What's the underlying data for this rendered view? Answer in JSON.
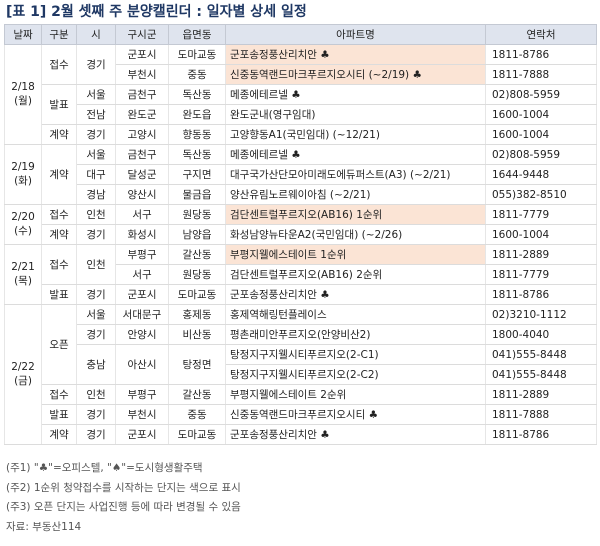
{
  "title": "[표 1] 2월 셋째 주 분양캘린더 : 일자별 상세 일정",
  "columns": [
    "날짜",
    "구분",
    "시",
    "구시군",
    "읍면동",
    "아파트명",
    "연락처"
  ],
  "dates": [
    "2/18 (월)",
    "2/19 (화)",
    "2/20 (수)",
    "2/21 (목)",
    "2/22 (금)"
  ],
  "types": [
    "접수",
    "발표",
    "계약",
    "계약",
    "접수",
    "계약",
    "접수",
    "발표",
    "오픈",
    "접수",
    "발표",
    "계약"
  ],
  "cities": [
    "경기",
    "서울",
    "전남",
    "경기",
    "서울",
    "대구",
    "경남",
    "인천",
    "경기",
    "인천",
    "경기",
    "서울",
    "경기",
    "충남",
    "인천",
    "경기",
    "경기"
  ],
  "rows": [
    {
      "gu": "군포시",
      "dong": "도마교동",
      "apt": "군포송정풍산리치안 ♣",
      "phone": "1811-8786",
      "highlight": true
    },
    {
      "gu": "부천시",
      "dong": "중동",
      "apt": "신중동역랜드마크푸르지오시티 (~2/19) ♣",
      "phone": "1811-7888",
      "highlight": true
    },
    {
      "gu": "금천구",
      "dong": "독산동",
      "apt": "메종에테르넬 ♣",
      "phone": "02)808-5959",
      "highlight": false
    },
    {
      "gu": "완도군",
      "dong": "완도읍",
      "apt": "완도군내(영구임대)",
      "phone": "1600-1004",
      "highlight": false
    },
    {
      "gu": "고양시",
      "dong": "향동동",
      "apt": "고양향동A1(국민임대) (~12/21)",
      "phone": "1600-1004",
      "highlight": false
    },
    {
      "gu": "금천구",
      "dong": "독산동",
      "apt": "메종에테르넬 ♣",
      "phone": "02)808-5959",
      "highlight": false
    },
    {
      "gu": "달성군",
      "dong": "구지면",
      "apt": "대구국가산단모아미래도에듀퍼스트(A3) (~2/21)",
      "phone": "1644-9448",
      "highlight": false
    },
    {
      "gu": "양산시",
      "dong": "물금읍",
      "apt": "양산유림노르웨이아침 (~2/21)",
      "phone": "055)382-8510",
      "highlight": false
    },
    {
      "gu": "서구",
      "dong": "원당동",
      "apt": "검단센트럴푸르지오(AB16) 1순위",
      "phone": "1811-7779",
      "highlight": true
    },
    {
      "gu": "화성시",
      "dong": "남양읍",
      "apt": "화성남양뉴타운A2(국민임대) (~2/26)",
      "phone": "1600-1004",
      "highlight": false
    },
    {
      "gu": "부평구",
      "dong": "갈산동",
      "apt": "부평지웰에스테이트 1순위",
      "phone": "1811-2889",
      "highlight": true
    },
    {
      "gu": "서구",
      "dong": "원당동",
      "apt": "검단센트럴푸르지오(AB16) 2순위",
      "phone": "1811-7779",
      "highlight": false
    },
    {
      "gu": "군포시",
      "dong": "도마교동",
      "apt": "군포송정풍산리치안 ♣",
      "phone": "1811-8786",
      "highlight": false
    },
    {
      "gu": "서대문구",
      "dong": "홍제동",
      "apt": "홍제역해링턴플레이스",
      "phone": "02)3210-1112",
      "highlight": false
    },
    {
      "gu": "안양시",
      "dong": "비산동",
      "apt": "평촌래미안푸르지오(안양비산2)",
      "phone": "1800-4040",
      "highlight": false
    },
    {
      "gu": "아산시",
      "dong": "탕정면",
      "apt": "탕정지구지웰시티푸르지오(2-C1)",
      "phone": "041)555-8448",
      "highlight": false
    },
    {
      "gu": "",
      "dong": "",
      "apt": "탕정지구지웰시티푸르지오(2-C2)",
      "phone": "041)555-8448",
      "highlight": false
    },
    {
      "gu": "부평구",
      "dong": "갈산동",
      "apt": "부평지웰에스테이트 2순위",
      "phone": "1811-2889",
      "highlight": false
    },
    {
      "gu": "부천시",
      "dong": "중동",
      "apt": "신중동역랜드마크푸르지오시티 ♣",
      "phone": "1811-7888",
      "highlight": false
    },
    {
      "gu": "군포시",
      "dong": "도마교동",
      "apt": "군포송정풍산리치안 ♣",
      "phone": "1811-8786",
      "highlight": false
    }
  ],
  "notes": [
    "(주1) \"♣\"=오피스텔, \"♠\"=도시형생활주택",
    "(주2) 1순위 청약접수를 시작하는 단지는 색으로 표시",
    "(주3) 오픈 단지는 사업진행 등에 따라 변경될 수 있음",
    "자료: 부동산114"
  ],
  "colors": {
    "header_bg": "#dfe4ee",
    "highlight_bg": "#fbe4d5",
    "title": "#1f3864"
  }
}
